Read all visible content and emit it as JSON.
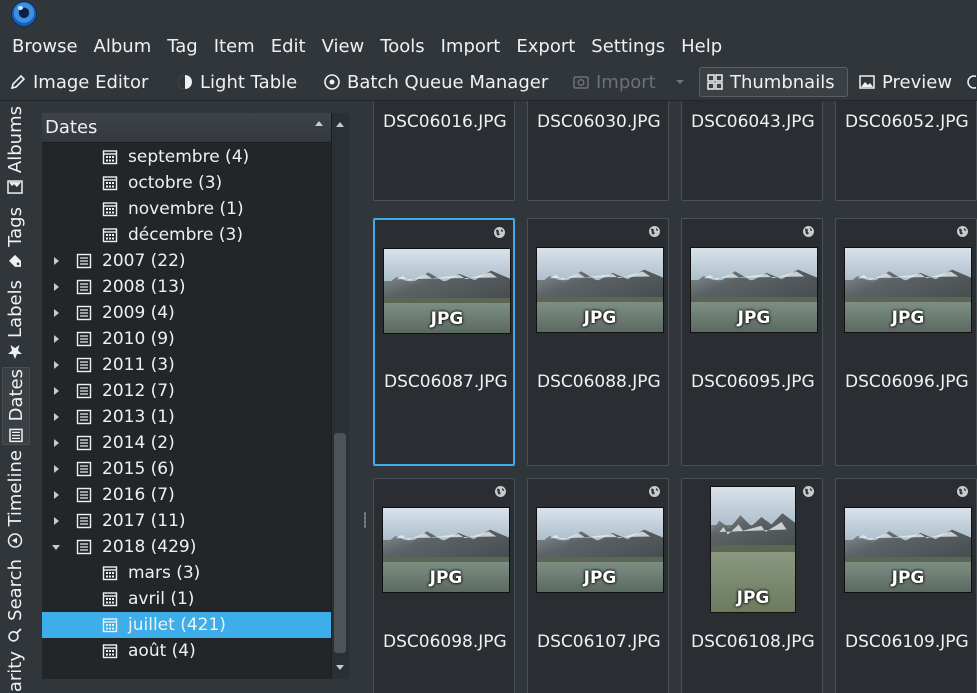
{
  "menu": [
    {
      "label": "Browse"
    },
    {
      "label": "Album"
    },
    {
      "label": "Tag"
    },
    {
      "label": "Item"
    },
    {
      "label": "Edit"
    },
    {
      "label": "View"
    },
    {
      "label": "Tools"
    },
    {
      "label": "Import"
    },
    {
      "label": "Export"
    },
    {
      "label": "Settings"
    },
    {
      "label": "Help"
    }
  ],
  "toolbar": {
    "image_editor": "Image Editor",
    "light_table": "Light Table",
    "batch_queue": "Batch Queue Manager",
    "import": "Import",
    "thumbnails": "Thumbnails",
    "preview": "Preview"
  },
  "side_tabs": {
    "albums": "Albums",
    "tags": "Tags",
    "labels": "Labels",
    "dates": "Dates",
    "timeline": "Timeline",
    "search": "Search",
    "similarity": "arity"
  },
  "dates_panel": {
    "header": "Dates",
    "rows": [
      {
        "label": "septembre (4)",
        "kind": "month"
      },
      {
        "label": "octobre (3)",
        "kind": "month"
      },
      {
        "label": "novembre (1)",
        "kind": "month"
      },
      {
        "label": "décembre (3)",
        "kind": "month"
      },
      {
        "label": "2007 (22)",
        "kind": "year",
        "expanded": false
      },
      {
        "label": "2008 (13)",
        "kind": "year",
        "expanded": false
      },
      {
        "label": "2009 (4)",
        "kind": "year",
        "expanded": false
      },
      {
        "label": "2010 (9)",
        "kind": "year",
        "expanded": false
      },
      {
        "label": "2011 (3)",
        "kind": "year",
        "expanded": false
      },
      {
        "label": "2012 (7)",
        "kind": "year",
        "expanded": false
      },
      {
        "label": "2013 (1)",
        "kind": "year",
        "expanded": false
      },
      {
        "label": "2014 (2)",
        "kind": "year",
        "expanded": false
      },
      {
        "label": "2015 (6)",
        "kind": "year",
        "expanded": false
      },
      {
        "label": "2016 (7)",
        "kind": "year",
        "expanded": false
      },
      {
        "label": "2017 (11)",
        "kind": "year",
        "expanded": false
      },
      {
        "label": "2018 (429)",
        "kind": "year",
        "expanded": true
      },
      {
        "label": "mars (3)",
        "kind": "month"
      },
      {
        "label": "avril (1)",
        "kind": "month"
      },
      {
        "label": "juillet (421)",
        "kind": "month",
        "selected": true
      },
      {
        "label": "août (4)",
        "kind": "month"
      }
    ]
  },
  "thumbnails": {
    "row1": [
      "DSC06016.JPG",
      "DSC06030.JPG",
      "DSC06043.JPG",
      "DSC06052.JPG"
    ],
    "row2": [
      "DSC06087.JPG",
      "DSC06088.JPG",
      "DSC06095.JPG",
      "DSC06096.JPG"
    ],
    "row3": [
      "DSC06098.JPG",
      "DSC06107.JPG",
      "DSC06108.JPG",
      "DSC06109.JPG"
    ],
    "badge": "JPG",
    "selected": "DSC06087.JPG"
  },
  "colors": {
    "background": "#31363b",
    "panel": "#232629",
    "accent": "#3daee9",
    "text": "#eff0f1"
  }
}
